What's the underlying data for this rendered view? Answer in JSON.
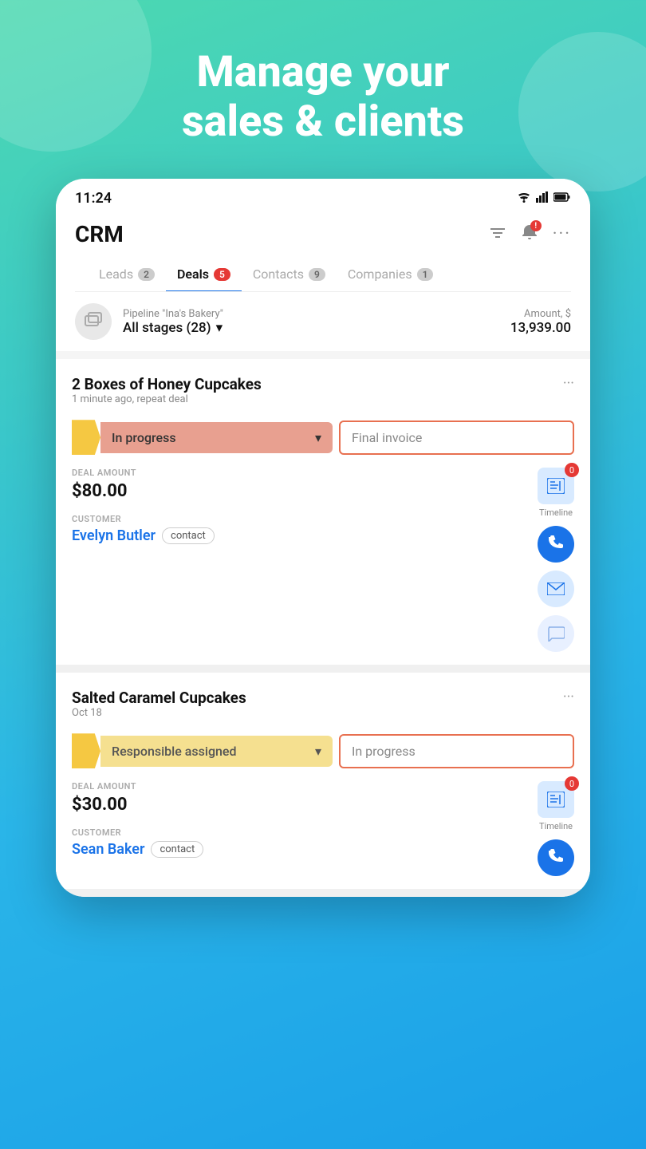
{
  "hero": {
    "line1": "Manage your",
    "line2": "sales & clients"
  },
  "status_bar": {
    "time": "11:24",
    "wifi": "▼",
    "signal": "▲",
    "battery": "🔋"
  },
  "header": {
    "title": "CRM",
    "filter_icon": "≡",
    "notify_icon": "🔔",
    "more_icon": "···"
  },
  "tabs": [
    {
      "label": "Leads",
      "badge": "2",
      "active": false
    },
    {
      "label": "Deals",
      "badge": "5",
      "active": true
    },
    {
      "label": "Contacts",
      "badge": "9",
      "active": false
    },
    {
      "label": "Companies",
      "badge": "1",
      "active": false
    }
  ],
  "pipeline": {
    "name_label": "Pipeline \"Ina's Bakery\"",
    "stages_label": "All stages (28)",
    "amount_label": "Amount, $",
    "amount_value": "13,939.00"
  },
  "deals": [
    {
      "title": "2 Boxes of Honey Cupcakes",
      "meta": "1 minute ago, repeat deal",
      "stage": "In progress",
      "next_stage": "Final invoice",
      "deal_amount_label": "DEAL AMOUNT",
      "deal_amount": "$80.00",
      "customer_label": "CUSTOMER",
      "customer_name": "Evelyn Butler",
      "customer_badge": "contact",
      "timeline_count": "0",
      "stage_color": "salmon",
      "more_icon": "···"
    },
    {
      "title": "Salted Caramel Cupcakes",
      "meta": "Oct 18",
      "stage": "Responsible assigned",
      "next_stage": "In progress",
      "deal_amount_label": "DEAL AMOUNT",
      "deal_amount": "$30.00",
      "customer_label": "CUSTOMER",
      "customer_name": "Sean Baker",
      "customer_badge": "contact",
      "timeline_count": "0",
      "stage_color": "yellow",
      "more_icon": "···"
    }
  ]
}
